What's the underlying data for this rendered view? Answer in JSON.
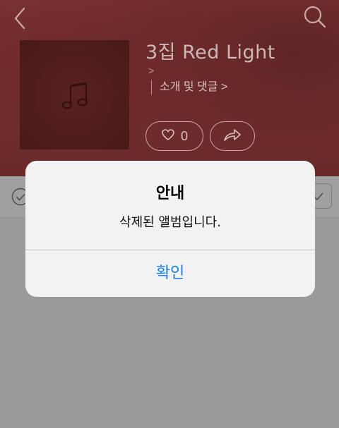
{
  "header": {
    "back_icon": "chevron-left-icon",
    "search_icon": "search-icon"
  },
  "album": {
    "title": "3집 Red Light",
    "artist_chevron": ">",
    "intro_link": "소개 및 댓글 >",
    "cover_icon": "music-note-icon",
    "like_count": "0",
    "share_icon": "share-icon"
  },
  "action_row": {
    "select_all_icon": "check-circle-icon",
    "right_icon": "check-icon"
  },
  "alert": {
    "title": "안내",
    "message": "삭제된 앨범입니다.",
    "confirm_label": "확인"
  },
  "colors": {
    "accent": "#1a7ff2",
    "header_bg": "#6e2c2c",
    "dim_bg": "#9a9a9a",
    "alert_bg": "#f2f2f2"
  }
}
